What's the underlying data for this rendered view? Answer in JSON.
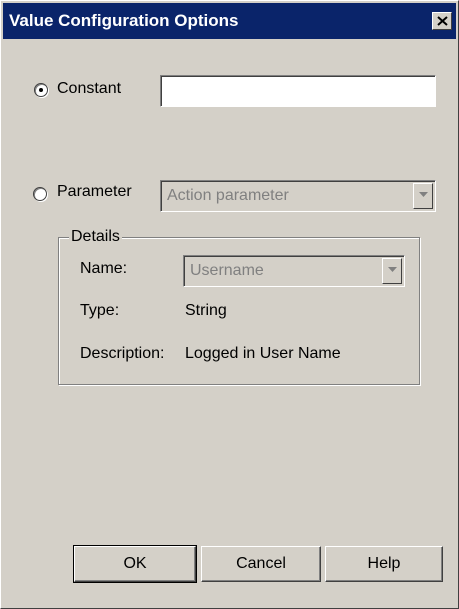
{
  "window": {
    "title": "Value Configuration Options"
  },
  "constant": {
    "label": "Constant",
    "selected": true,
    "value": ""
  },
  "parameter": {
    "label": "Parameter",
    "selected": false,
    "type_value": "Action parameter"
  },
  "details": {
    "legend": "Details",
    "name_label": "Name:",
    "name_value": "Username",
    "type_label": "Type:",
    "type_value": "String",
    "description_label": "Description:",
    "description_value": "Logged in User Name"
  },
  "buttons": {
    "ok": "OK",
    "cancel": "Cancel",
    "help": "Help"
  },
  "icons": {
    "close": "close-icon",
    "dropdown": "chevron-down-icon",
    "radio": "radio-dot-icon"
  },
  "colors": {
    "titlebar": "#0a246a",
    "face": "#d4d0c8",
    "disabled_text": "#808080"
  }
}
